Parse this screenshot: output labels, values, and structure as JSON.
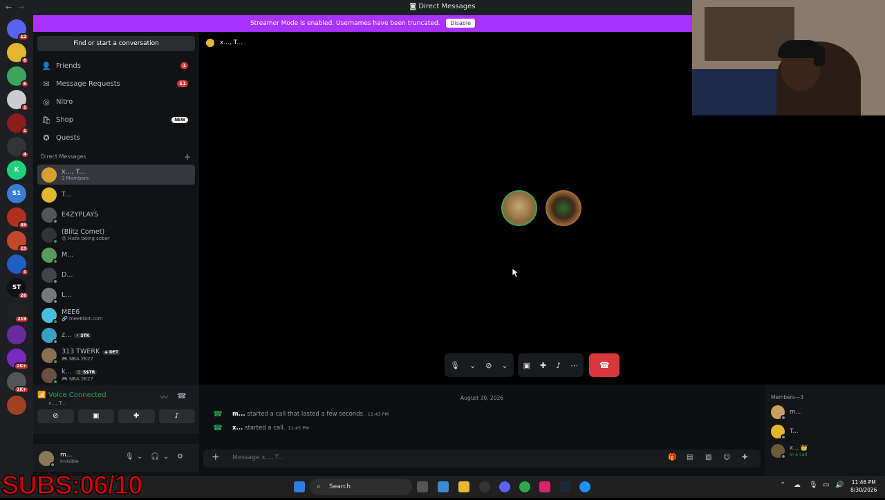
{
  "window": {
    "title": "Direct Messages",
    "back": "←",
    "forward": "→"
  },
  "banner": {
    "text": "Streamer Mode is enabled. Usernames have been truncated.",
    "button": "Disable"
  },
  "guilds": [
    {
      "name": "home",
      "color": "#5865f2",
      "label": "",
      "badge": "12"
    },
    {
      "name": "server-1",
      "color": "#e2b830",
      "label": "",
      "badge": "6"
    },
    {
      "name": "server-2",
      "color": "#3ba55d",
      "label": "",
      "badge": "6"
    },
    {
      "name": "server-3",
      "color": "#ccc",
      "label": "",
      "badge": "1"
    },
    {
      "name": "server-4",
      "color": "#8b1d1d",
      "label": "",
      "badge": "1"
    },
    {
      "name": "server-5",
      "color": "#333",
      "label": "",
      "badge": "4"
    },
    {
      "name": "server-k",
      "color": "#1fd17a",
      "label": "K",
      "badge": ""
    },
    {
      "name": "server-s1",
      "color": "#3a7bd5",
      "label": "S1",
      "badge": ""
    },
    {
      "name": "server-6",
      "color": "#b03020",
      "label": "",
      "badge": "35"
    },
    {
      "name": "server-7",
      "color": "#c24a2a",
      "label": "",
      "badge": "19"
    },
    {
      "name": "server-8",
      "color": "#1e5fbf",
      "label": "",
      "badge": "1"
    },
    {
      "name": "server-st",
      "color": "#111",
      "label": "ST",
      "badge": "26"
    },
    {
      "name": "server-9",
      "color": "#222",
      "label": "",
      "badge": "219"
    },
    {
      "name": "server-10",
      "color": "#6a2aa0",
      "label": "",
      "badge": ""
    },
    {
      "name": "server-11",
      "color": "#7a2ac0",
      "label": "",
      "badge": "2K+"
    },
    {
      "name": "server-12",
      "color": "#555",
      "label": "",
      "badge": "1K+"
    },
    {
      "name": "server-13",
      "color": "#a04020",
      "label": "",
      "badge": ""
    }
  ],
  "sidebar": {
    "find": "Find or start a conversation",
    "nav": [
      {
        "label": "Friends",
        "icon": "👤",
        "count": "1",
        "new": ""
      },
      {
        "label": "Message Requests",
        "icon": "✉",
        "count": "11",
        "new": ""
      },
      {
        "label": "Nitro",
        "icon": "◎",
        "count": "",
        "new": ""
      },
      {
        "label": "Shop",
        "icon": "🛍",
        "count": "",
        "new": "NEW"
      },
      {
        "label": "Quests",
        "icon": "✪",
        "count": "",
        "new": ""
      }
    ],
    "dm_header": "Direct Messages",
    "dms": [
      {
        "name": "x..., T...",
        "sub": "3 Members",
        "tag": "",
        "color": "#d4a030",
        "status": "",
        "selected": true
      },
      {
        "name": "T...",
        "sub": "",
        "tag": "",
        "color": "#e2b830",
        "status": "",
        "selected": false
      },
      {
        "name": "E4ZYPLAYS",
        "sub": "",
        "tag": "",
        "color": "#555",
        "status": "off",
        "selected": false
      },
      {
        "name": "(Blitz Comet)",
        "sub": "😮 Hate being sober",
        "tag": "",
        "color": "#333",
        "status": "on",
        "selected": false
      },
      {
        "name": "M...",
        "sub": "",
        "tag": "",
        "color": "#5a9a5a",
        "status": "on",
        "selected": false
      },
      {
        "name": "D...",
        "sub": "",
        "tag": "",
        "color": "#444",
        "status": "off",
        "selected": false
      },
      {
        "name": "L...",
        "sub": "",
        "tag": "",
        "color": "#777",
        "status": "off",
        "selected": false
      },
      {
        "name": "MEE6",
        "sub": "🔗 mee6bot.com",
        "tag": "",
        "color": "#4ac0e0",
        "status": "on",
        "selected": false
      },
      {
        "name": "z...",
        "sub": "",
        "tag": "⚡ STK",
        "color": "#3aa0c0",
        "status": "off",
        "selected": false
      },
      {
        "name": "313 TWERK",
        "sub": "🎮 NBA 2K27",
        "tag": "◈ DET",
        "color": "#8a7050",
        "status": "on",
        "selected": false
      },
      {
        "name": "k...",
        "sub": "🎮 NBA 2K27",
        "tag": "💲 S$TR",
        "color": "#6a5040",
        "status": "on",
        "selected": false
      }
    ]
  },
  "voice": {
    "status": "Voice Connected",
    "channel": "x..., T..."
  },
  "user": {
    "name": "m...",
    "status": "Invisible"
  },
  "overlay": {
    "subs": "SUBS:06/10"
  },
  "call": {
    "header": "x..., T..."
  },
  "chat": {
    "date": "August 30, 2026",
    "messages": [
      {
        "author": "m...",
        "text": "started a call that lasted a few seconds.",
        "time": "11:43 PM"
      },
      {
        "author": "x...",
        "text": "started a call.",
        "time": "11:45 PM"
      }
    ],
    "placeholder": "Message x..., T...",
    "add": "+"
  },
  "members": {
    "header": "Members—3",
    "list": [
      {
        "name": "m...",
        "sub": "",
        "color": "#c8a060",
        "crown": ""
      },
      {
        "name": "T...",
        "sub": "",
        "color": "#e2b830",
        "crown": ""
      },
      {
        "name": "x...",
        "sub": "In a call",
        "color": "#6a5a3a",
        "crown": "👑"
      }
    ]
  },
  "taskbar": {
    "search": "Search",
    "time": "11:46 PM",
    "date": "8/30/2026"
  }
}
